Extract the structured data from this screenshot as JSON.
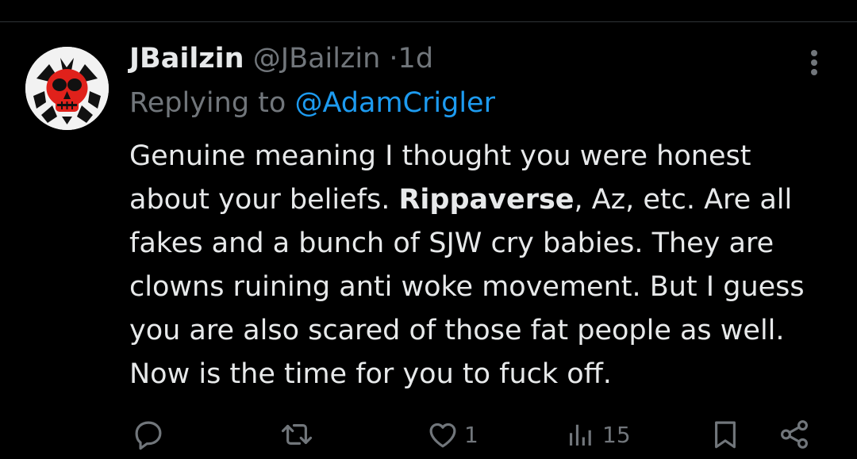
{
  "tweet": {
    "display_name": "JBailzin",
    "handle": "@JBailzin",
    "separator": "·",
    "time": "1d",
    "replying_prefix": "Replying to",
    "replying_handle": "@AdamCrigler",
    "text_part1": "Genuine meaning I thought you were honest about your beliefs. ",
    "text_bold": "Rippaverse",
    "text_part2": ", Az, etc. Are all fakes and a bunch of SJW cry babies. They are clowns ruining anti woke movement. But I guess you are also scared of those fat people as well. Now is the time for you to fuck off."
  },
  "actions": {
    "reply_count": "",
    "retweet_count": "",
    "like_count": "1",
    "views_count": "15"
  },
  "icons": {
    "avatar": "skull-avatar-icon",
    "more": "more-options-icon",
    "reply": "reply-icon",
    "retweet": "retweet-icon",
    "like": "heart-icon",
    "views": "views-bar-chart-icon",
    "bookmark": "bookmark-icon",
    "share": "share-icon"
  },
  "colors": {
    "background": "#000000",
    "text": "#e7e9ea",
    "secondary": "#71767b",
    "link": "#1d9bf0",
    "avatar_red": "#e0211b"
  }
}
